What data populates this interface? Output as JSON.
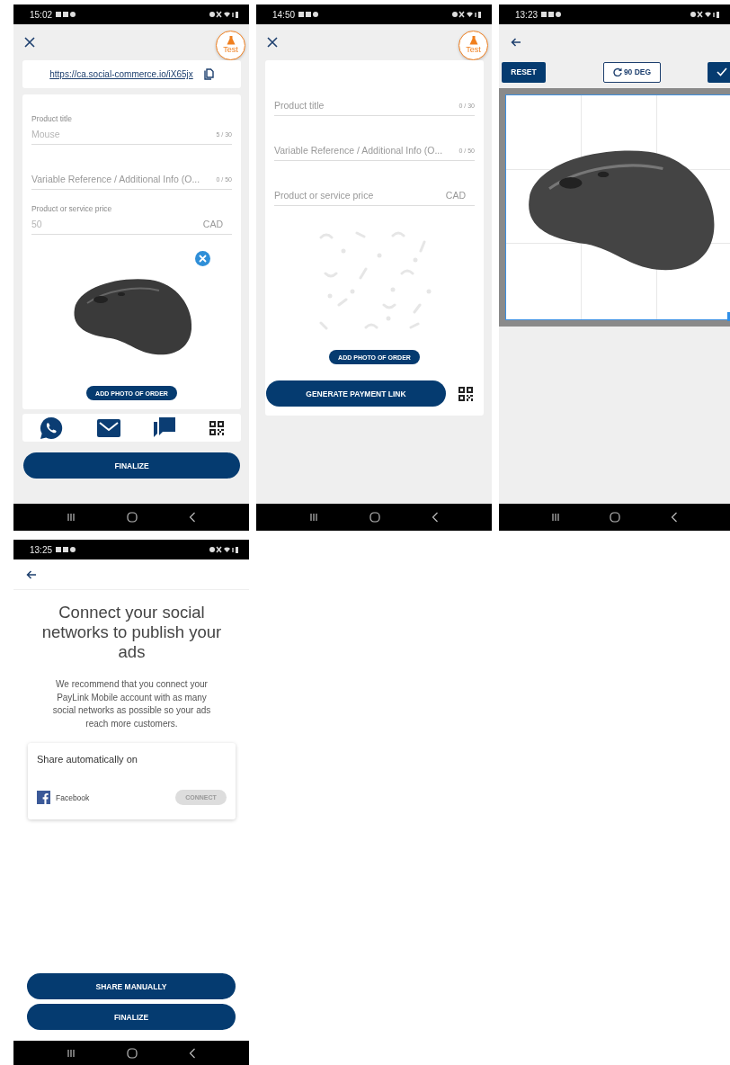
{
  "screens": [
    {
      "kind": "order_summary",
      "status_bar": {
        "time": "15:02"
      },
      "test_badge": "Test",
      "link": "https://ca.social-commerce.io/iX65jx",
      "fields": [
        {
          "label": "Product title",
          "value": "Mouse",
          "counter": "5 / 30"
        },
        {
          "placeholder": "Variable Reference / Additional Info (O...",
          "counter": "0 / 50"
        },
        {
          "label": "Product or service price",
          "value": "50",
          "suffix": "CAD"
        }
      ],
      "add_photo_button": "ADD PHOTO OF ORDER",
      "primary_button": "FINALIZE"
    },
    {
      "kind": "order_new",
      "status_bar": {
        "time": "14:50"
      },
      "test_badge": "Test",
      "fields": [
        {
          "placeholder": "Product title",
          "counter": "0 / 30"
        },
        {
          "placeholder": "Variable Reference / Additional Info (O...",
          "counter": "0 / 50"
        },
        {
          "placeholder": "Product or service price",
          "suffix": "CAD"
        }
      ],
      "add_photo_button": "ADD PHOTO OF ORDER",
      "primary_button": "GENERATE PAYMENT LINK"
    },
    {
      "kind": "crop",
      "status_bar": {
        "time": "13:23"
      },
      "reset_button": "RESET",
      "rotate_button": "90 DEG"
    },
    {
      "kind": "social",
      "status_bar": {
        "time": "13:25"
      },
      "title": "Connect your social networks to publish your ads",
      "description": "We recommend that you connect your PayLink Mobile account with as many social networks as possible so your ads reach more customers.",
      "share_card": {
        "heading": "Share automatically on",
        "networks": [
          {
            "name": "Facebook",
            "button": "CONNECT",
            "disabled": true
          }
        ]
      },
      "buttons": [
        "SHARE MANUALLY",
        "FINALIZE"
      ]
    }
  ]
}
